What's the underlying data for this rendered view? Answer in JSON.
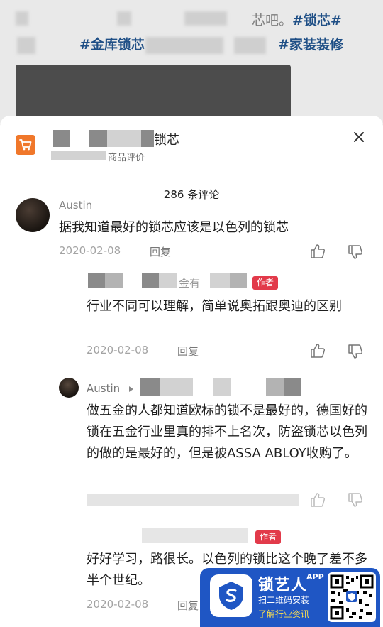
{
  "background_post": {
    "line1_text": "芯吧。",
    "line1_tag": "#锁芯#",
    "line2_tag1": "#金库锁芯",
    "line2_tag2": "#家装装修"
  },
  "product": {
    "name_suffix": "锁芯",
    "subtitle": "商品评价"
  },
  "comments": {
    "count_label": "286 条评论",
    "items": [
      {
        "username": "Austin",
        "text": "据我知道最好的锁芯应该是以色列的锁芯",
        "date": "2020-02-08",
        "reply_label": "回复"
      },
      {
        "username_part": "金有",
        "author_badge": "作者",
        "text": "行业不同可以理解，简单说奥拓跟奥迪的区别",
        "date": "2020-02-08",
        "reply_label": "回复"
      },
      {
        "username": "Austin",
        "text": "做五金的人都知道欧标的锁不是最好的，德国好的锁在五金行业里真的排不上名次，防盗锁芯以色列的做的是最好的，但是被ASSA ABLOY收购了。"
      },
      {
        "author_badge": "作者",
        "text": "好好学习，路很长。以色列的锁比这个晚了差不多半个世纪。",
        "date": "2020-02-08",
        "reply_label": "回复"
      }
    ]
  },
  "brand_banner": {
    "name": "锁艺人",
    "app_label": "APP",
    "scan_text": "扫二维码安装",
    "learn_text": "了解行业资讯"
  },
  "colors": {
    "accent_orange": "#f0772a",
    "author_badge": "#e23a4a",
    "brand_blue": "#1f56c4",
    "tag_blue": "#1f4f86"
  }
}
